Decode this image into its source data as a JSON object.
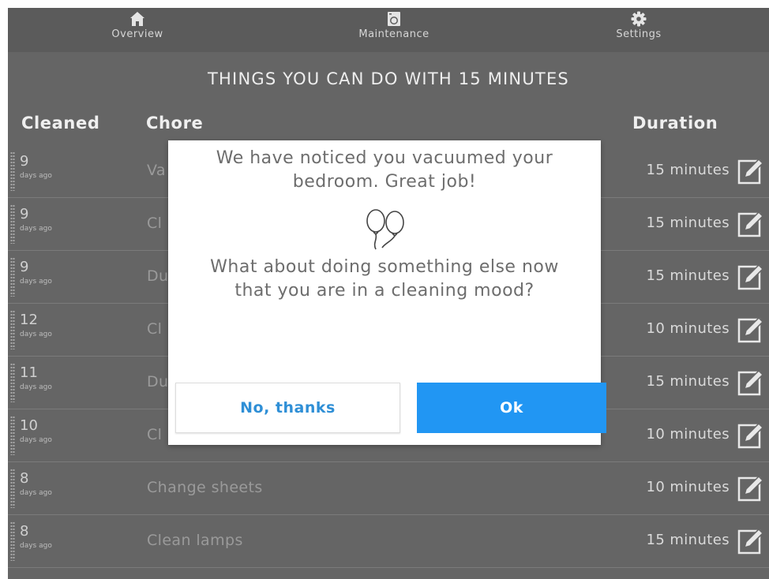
{
  "nav": [
    {
      "label": "Overview",
      "icon": "home-icon"
    },
    {
      "label": "Maintenance",
      "icon": "washing-machine-icon"
    },
    {
      "label": "Settings",
      "icon": "gear-icon"
    }
  ],
  "heading": "THINGS YOU CAN DO WITH 15 MINUTES",
  "columns": {
    "cleaned": "Cleaned",
    "chore": "Chore",
    "duration": "Duration"
  },
  "rows": [
    {
      "days": "9",
      "days_label": "days ago",
      "chore": "Va",
      "duration": "15 minutes"
    },
    {
      "days": "9",
      "days_label": "days ago",
      "chore": "Cl",
      "duration": "15 minutes"
    },
    {
      "days": "9",
      "days_label": "days ago",
      "chore": "Du",
      "duration": "15 minutes"
    },
    {
      "days": "12",
      "days_label": "days ago",
      "chore": "Cl",
      "duration": "10 minutes"
    },
    {
      "days": "11",
      "days_label": "days ago",
      "chore": "Du",
      "duration": "15 minutes"
    },
    {
      "days": "10",
      "days_label": "days ago",
      "chore": "Cl",
      "duration": "10 minutes"
    },
    {
      "days": "8",
      "days_label": "days ago",
      "chore": "Change sheets",
      "duration": "10 minutes"
    },
    {
      "days": "8",
      "days_label": "days ago",
      "chore": "Clean lamps",
      "duration": "15 minutes"
    }
  ],
  "dialog": {
    "message1_line1": "We have noticed you vacuumed your",
    "message1_line2": "bedroom. Great job!",
    "message2_line1": "What about doing something else now",
    "message2_line2": "that you are in a cleaning mood?",
    "decline_label": "No, thanks",
    "ok_label": "Ok"
  },
  "colors": {
    "background": "#656565",
    "accent": "#2196f3",
    "link": "#2f8fd6"
  }
}
